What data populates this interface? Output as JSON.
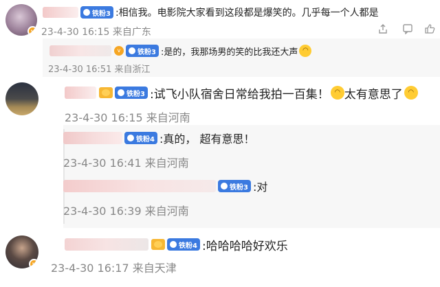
{
  "comments": [
    {
      "text": ":相信我。电影院大家看到这段都是爆笑的。几乎每一个人都是",
      "badge": "铁粉3",
      "date": "23-4-30",
      "time": "16:15",
      "location": "来自广东",
      "reply": {
        "badge": "铁粉3",
        "text": ":是的，我那场男的笑的比我还大声",
        "date": "23-4-30",
        "time": "16:51",
        "location": "来自浙江"
      }
    },
    {
      "text": ":试飞小队宿舍日常给我拍一百集！",
      "text2": "太有意思了",
      "badge": "铁粉3",
      "date": "23-4-30",
      "time": "16:15",
      "location": "来自河南",
      "replies": [
        {
          "badge": "铁粉4",
          "text": ":真的， 超有意思！",
          "date": "23-4-30",
          "time": "16:41",
          "location": "来自河南"
        },
        {
          "badge": "铁粉3",
          "text": ":对",
          "date": "23-4-30",
          "time": "16:39",
          "location": "来自河南"
        }
      ]
    },
    {
      "text": ":哈哈哈哈好欢乐",
      "badge": "铁粉4",
      "date": "23-4-30",
      "time": "16:17",
      "location": "来自天津"
    }
  ],
  "icons": {
    "share": "share-icon",
    "comment": "comment-icon",
    "like": "like-icon",
    "emoji_laugh": "laugh-emoji-icon",
    "emoji_cry_laugh": "cry-laugh-emoji-icon"
  },
  "colors": {
    "fan_badge": "#3b7ae0",
    "meta": "#888888",
    "reply_bg": "#f7f7f7"
  }
}
